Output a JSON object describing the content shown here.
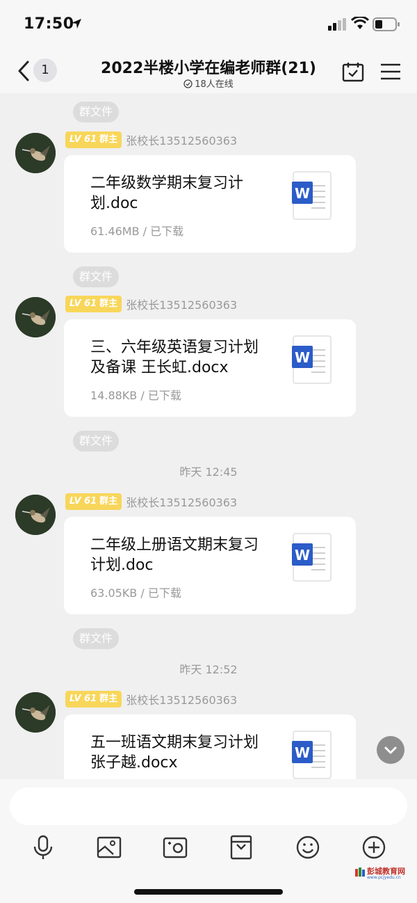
{
  "status_bar": {
    "time": "17:50"
  },
  "nav": {
    "unread_count": "1",
    "title": "2022半楼小学在编老师群(21)",
    "online": "18人在线"
  },
  "messages": [
    {
      "pill": "群文件",
      "sender_level": "LV 61",
      "sender_role": "群主",
      "sender_name": "张校长13512560363",
      "file_name": "二年级数学期末复习计划.doc",
      "file_meta": "61.46MB / 已下载"
    },
    {
      "pill": "群文件",
      "sender_level": "LV 61",
      "sender_role": "群主",
      "sender_name": "张校长13512560363",
      "file_name": "三、六年级英语复习计划及备课 王长虹.docx",
      "file_meta": "14.88KB / 已下载"
    },
    {
      "pill": "群文件",
      "time": "昨天 12:45",
      "sender_level": "LV 61",
      "sender_role": "群主",
      "sender_name": "张校长13512560363",
      "file_name": "二年级上册语文期末复习计划.doc",
      "file_meta": "63.05KB / 已下载"
    },
    {
      "pill": "群文件",
      "time": "昨天 12:52",
      "sender_level": "LV 61",
      "sender_role": "群主",
      "sender_name": "张校长13512560363",
      "file_name": "五一班语文期末复习计划 张子越.docx",
      "file_meta": ""
    }
  ],
  "input": {
    "placeholder": ""
  },
  "toolbar_icons": [
    "microphone-icon",
    "image-icon",
    "camera-icon",
    "file-icon",
    "emoji-icon",
    "plus-icon"
  ],
  "watermark": {
    "name": "彭城教育网",
    "url": "www.pcjyedu.cn"
  },
  "colors": {
    "badge": "#f8d65a",
    "word_blue": "#2b5cc8",
    "background": "#f0f0f0"
  }
}
